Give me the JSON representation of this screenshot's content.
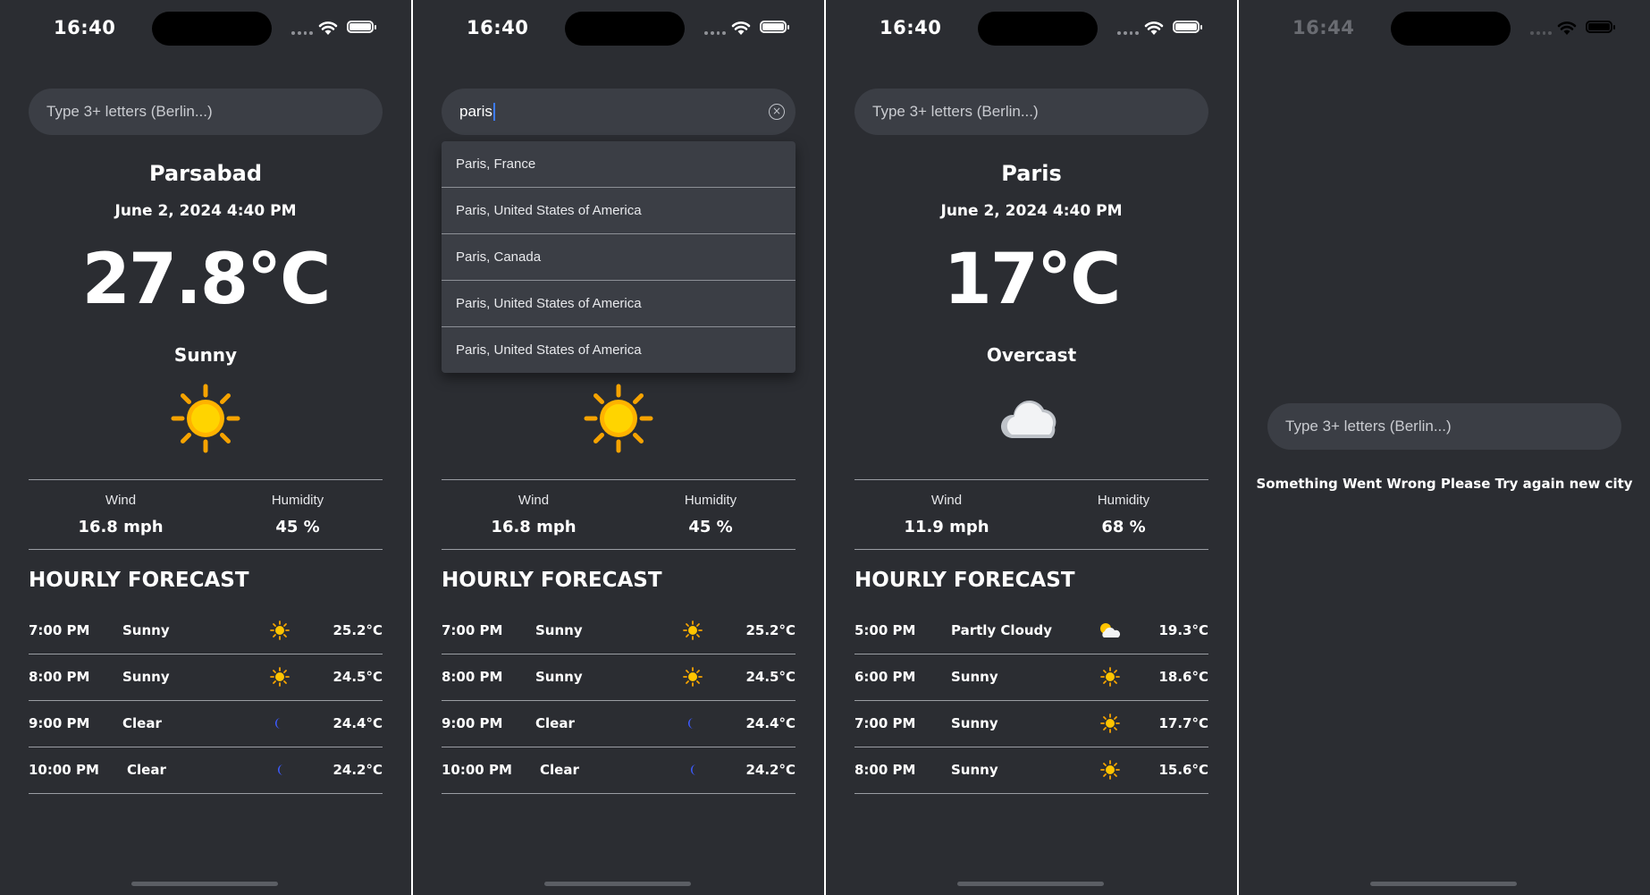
{
  "status": {
    "time_1": "16:40",
    "time_2": "16:40",
    "time_3": "16:40",
    "time_4": "16:44"
  },
  "search": {
    "placeholder": "Type 3+ letters (Berlin...)",
    "typed_value": "paris"
  },
  "labels": {
    "wind": "Wind",
    "humidity": "Humidity",
    "hourly_title": "HOURLY FORECAST"
  },
  "screen1": {
    "city": "Parsabad",
    "date": "June 2, 2024 4:40 PM",
    "temp": "27.8°C",
    "condition": "Sunny",
    "icon": "sun-icon",
    "wind": "16.8 mph",
    "humidity": "45 %",
    "hourly": [
      {
        "time": "7:00 PM",
        "cond": "Sunny",
        "icon": "sun-icon",
        "temp": "25.2°C"
      },
      {
        "time": "8:00 PM",
        "cond": "Sunny",
        "icon": "sun-icon",
        "temp": "24.5°C"
      },
      {
        "time": "9:00 PM",
        "cond": "Clear",
        "icon": "moon-icon",
        "temp": "24.4°C"
      },
      {
        "time": "10:00 PM",
        "cond": "Clear",
        "icon": "moon-icon",
        "temp": "24.2°C"
      }
    ]
  },
  "screen2": {
    "suggestions": [
      "Paris, France",
      "Paris, United States of America",
      "Paris, Canada",
      "Paris, United States of America",
      "Paris, United States of America"
    ],
    "icon": "sun-icon",
    "wind": "16.8 mph",
    "humidity": "45 %",
    "hourly": [
      {
        "time": "7:00 PM",
        "cond": "Sunny",
        "icon": "sun-icon",
        "temp": "25.2°C"
      },
      {
        "time": "8:00 PM",
        "cond": "Sunny",
        "icon": "sun-icon",
        "temp": "24.5°C"
      },
      {
        "time": "9:00 PM",
        "cond": "Clear",
        "icon": "moon-icon",
        "temp": "24.4°C"
      },
      {
        "time": "10:00 PM",
        "cond": "Clear",
        "icon": "moon-icon",
        "temp": "24.2°C"
      }
    ]
  },
  "screen3": {
    "city": "Paris",
    "date": "June 2, 2024 4:40 PM",
    "temp": "17°C",
    "condition": "Overcast",
    "icon": "cloud-icon",
    "wind": "11.9 mph",
    "humidity": "68 %",
    "hourly": [
      {
        "time": "5:00 PM",
        "cond": "Partly Cloudy",
        "icon": "partly-cloudy-icon",
        "temp": "19.3°C"
      },
      {
        "time": "6:00 PM",
        "cond": "Sunny",
        "icon": "sun-icon",
        "temp": "18.6°C"
      },
      {
        "time": "7:00 PM",
        "cond": "Sunny",
        "icon": "sun-icon",
        "temp": "17.7°C"
      },
      {
        "time": "8:00 PM",
        "cond": "Sunny",
        "icon": "sun-icon",
        "temp": "15.6°C"
      }
    ]
  },
  "screen4": {
    "error": "Something Went Wrong Please Try again new city"
  },
  "colors": {
    "background": "#2b2d32",
    "field": "#3b3e45",
    "sun": "#ffc400",
    "moon": "#3d5bff"
  }
}
